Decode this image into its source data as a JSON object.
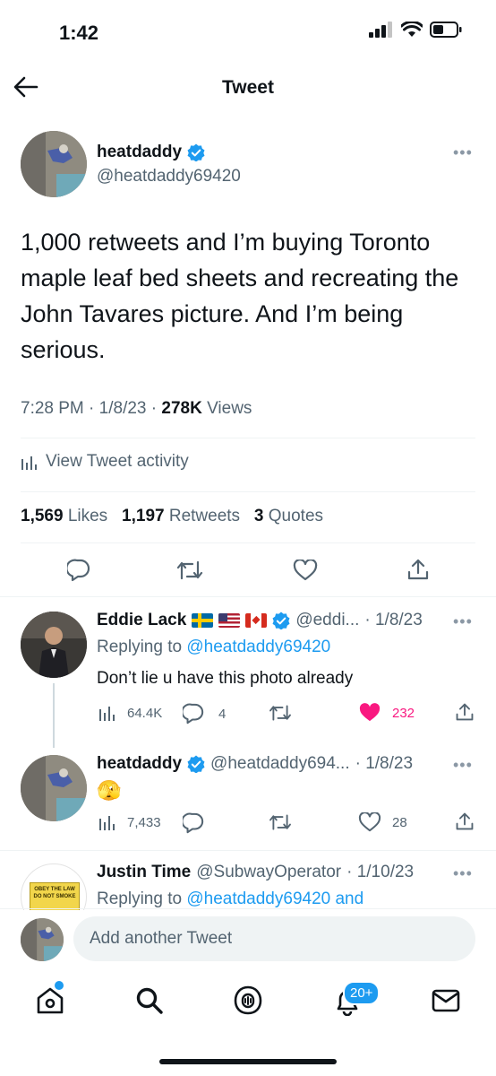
{
  "status_bar": {
    "time": "1:42"
  },
  "header": {
    "title": "Tweet"
  },
  "tweet": {
    "name": "heatdaddy",
    "handle": "@heatdaddy69420",
    "text": "1,000 retweets and I’m buying Toronto maple leaf bed sheets and recreating the John Tavares picture. And I’m being serious.",
    "time": "7:28 PM",
    "date": "1/8/23",
    "views_count": "278K",
    "views_label": "Views",
    "activity_label": "View Tweet activity",
    "likes_count": "1,569",
    "likes_label": "Likes",
    "retweets_count": "1,197",
    "retweets_label": "Retweets",
    "quotes_count": "3",
    "quotes_label": "Quotes"
  },
  "replies": [
    {
      "name": "Eddie Lack",
      "handle": "@eddi...",
      "date": "· 1/8/23",
      "replying_prefix": "Replying to",
      "replying_to": "@heatdaddy69420",
      "text": "Don’t lie u have this photo already",
      "views": "64.4K",
      "replies": "4",
      "likes": "232"
    },
    {
      "name": "heatdaddy",
      "handle": "@heatdaddy694...",
      "date": "· 1/8/23",
      "text": "🫣",
      "views": "7,433",
      "likes": "28"
    },
    {
      "name": "Justin Time",
      "handle": "@SubwayOperator",
      "date": "· 1/10/23",
      "replying_prefix": "Replying to",
      "replying_to": "@heatdaddy69420 and",
      "avatar_sign_text": "OBEY THE LAW DO NOT SMOKE"
    }
  ],
  "compose": {
    "placeholder": "Add another Tweet"
  },
  "tab_bar": {
    "notifications_badge": "20+"
  },
  "colors": {
    "accent": "#1d9bf0",
    "like": "#f91880",
    "text": "#0f1419",
    "muted": "#536471"
  }
}
